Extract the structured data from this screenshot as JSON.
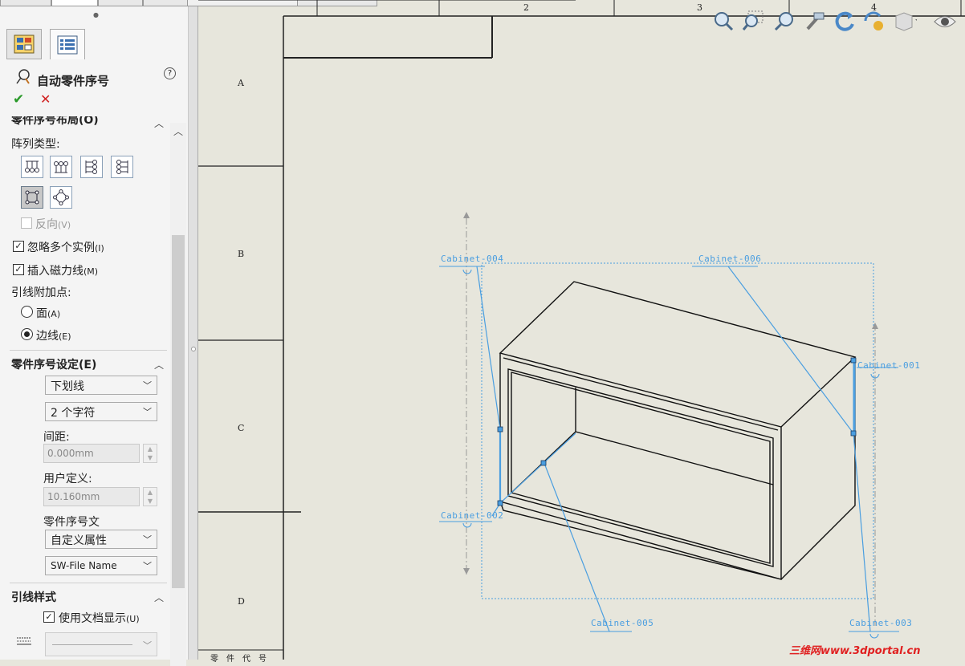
{
  "top_tabs": [
    "",
    "",
    "",
    "",
    ""
  ],
  "panel": {
    "title": "自动零件序号",
    "help": "?",
    "ok": "✔",
    "cancel": "✕",
    "layout_section": "零件序号布局(O)",
    "array_type_label": "阵列类型:",
    "reverse": "反向",
    "reverse_key": "(V)",
    "ignore_multiple": "忽略多个实例",
    "ignore_multiple_key": "(I)",
    "insert_magnetic": "插入磁力线",
    "insert_magnetic_key": "(M)",
    "leader_attach_label": "引线附加点:",
    "face": "面",
    "face_key": "(A)",
    "edge": "边线",
    "edge_key": "(E)",
    "settings_section": "零件序号设定(E)",
    "style_value": "下划线",
    "size_value": "2 个字符",
    "spacing_label": "间距:",
    "spacing_value": "0.000mm",
    "user_defined_label": "用户定义:",
    "user_defined_value": "10.160mm",
    "balloon_text_label": "零件序号文",
    "balloon_text_value": "自定义属性",
    "property_value": "SW-File Name",
    "leader_style_section": "引线样式",
    "use_doc_display": "使用文档显示",
    "use_doc_display_key": "(U)"
  },
  "drawing": {
    "columns": [
      "2",
      "3",
      "4"
    ],
    "rows": [
      "A",
      "B",
      "C",
      "D"
    ],
    "balloons": [
      "Cabinet-004",
      "Cabinet-006",
      "Cabinet-001",
      "Cabinet-002",
      "Cabinet-005",
      "Cabinet-003"
    ],
    "footer_cells": [
      "零",
      "件",
      "代",
      "号"
    ]
  },
  "view_toolbar": [
    "zoom-fit-icon",
    "zoom-area-icon",
    "zoom-prev-icon",
    "section-view-icon",
    "rotate-icon",
    "appearance-icon",
    "display-style-icon",
    "visibility-icon"
  ],
  "watermark": "三维网www.3dportal.cn",
  "colors": {
    "annotation": "#4a9ee0",
    "paper": "#e7e6dc",
    "watermark": "#e02020"
  }
}
